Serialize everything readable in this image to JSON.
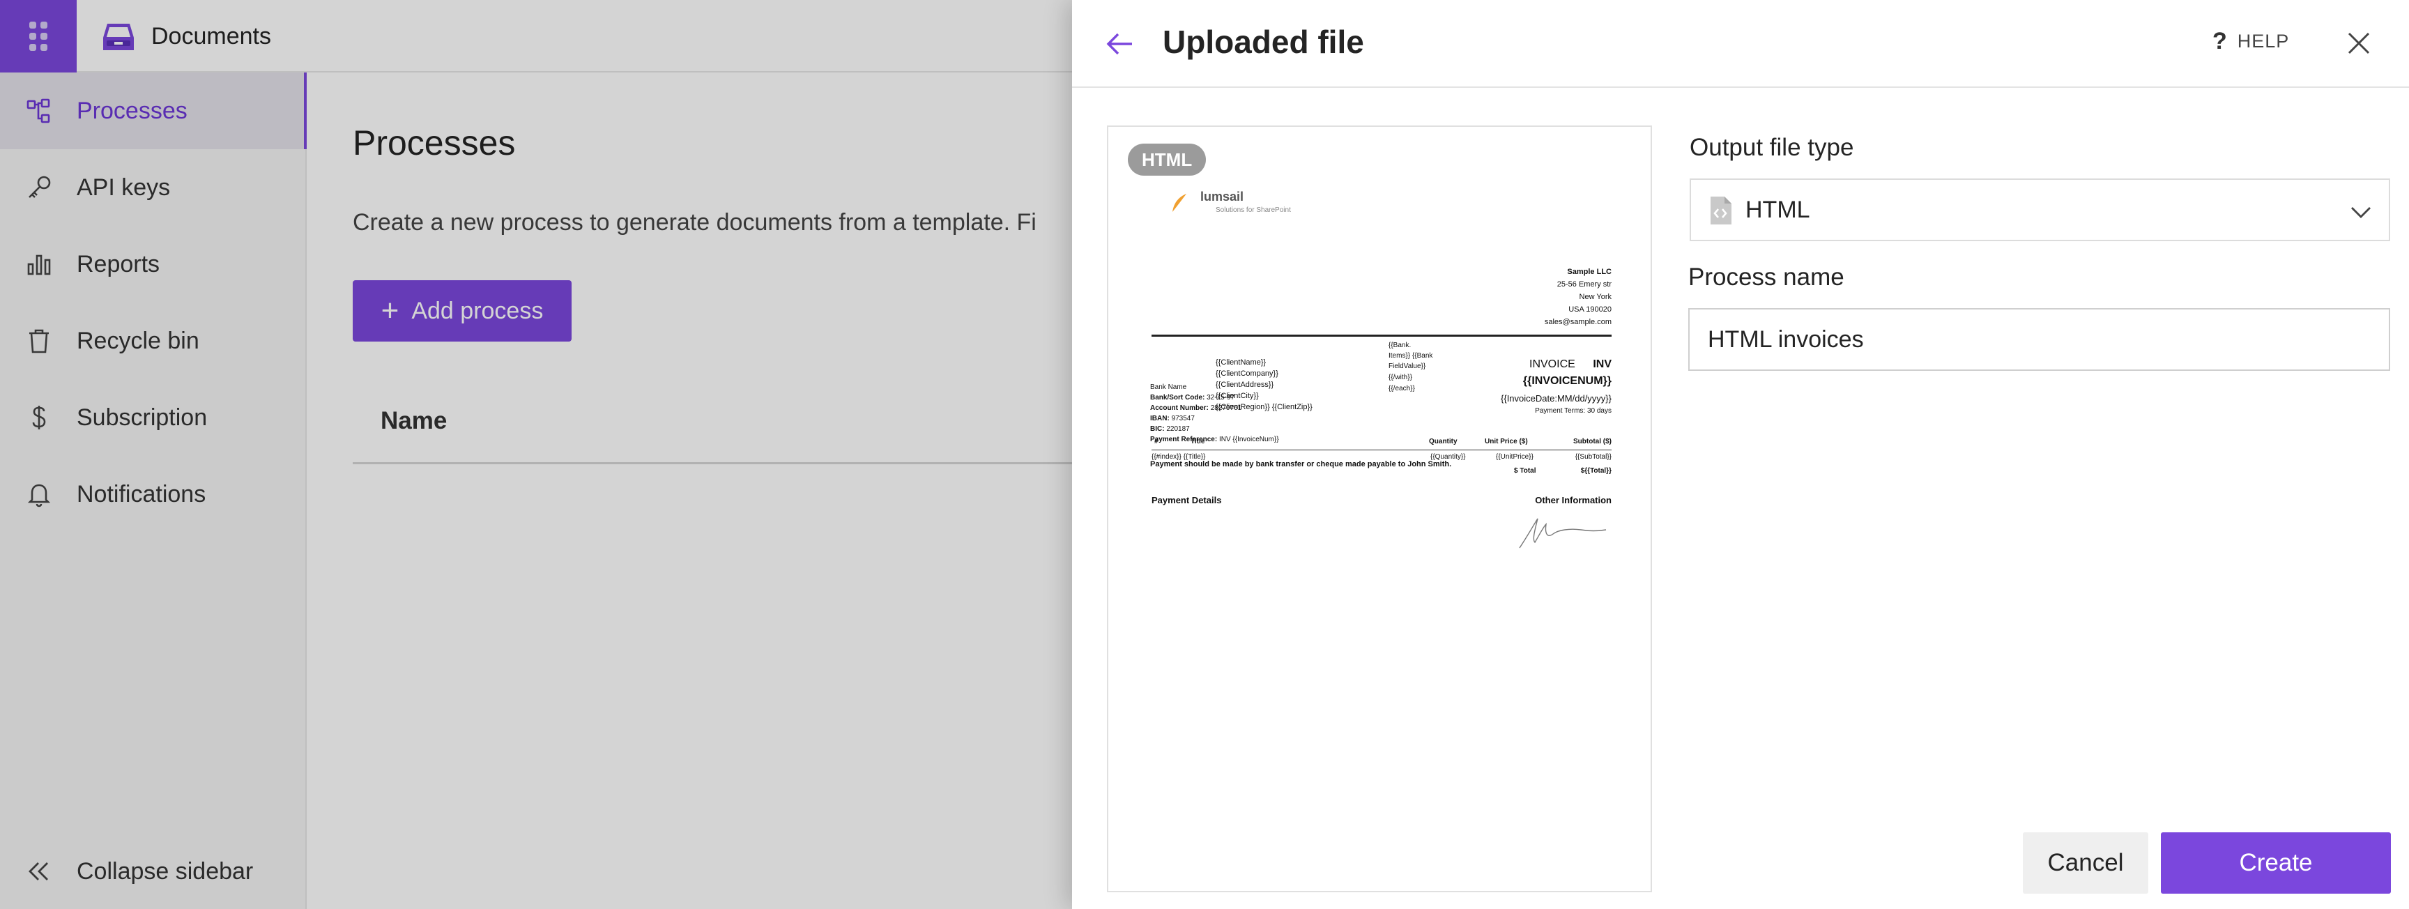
{
  "app": {
    "name": "Documents",
    "app_launcher_icon": "waffle-grid-icon",
    "brand_icon": "documents-tray-icon"
  },
  "colors": {
    "accent": "#7b47dd",
    "active_nav_bg": "#e4e1ea",
    "secondary_button_bg": "#efefef"
  },
  "sidebar": {
    "items": [
      {
        "label": "Processes",
        "icon": "processes-icon",
        "active": true
      },
      {
        "label": "API keys",
        "icon": "key-icon",
        "active": false
      },
      {
        "label": "Reports",
        "icon": "bar-chart-icon",
        "active": false
      },
      {
        "label": "Recycle bin",
        "icon": "trash-icon",
        "active": false
      },
      {
        "label": "Subscription",
        "icon": "dollar-icon",
        "active": false
      },
      {
        "label": "Notifications",
        "icon": "bell-icon",
        "active": false
      }
    ],
    "collapse_label": "Collapse sidebar"
  },
  "main": {
    "title": "Processes",
    "description": "Create a new process to generate documents from a template. Fi",
    "add_button_label": "Add process",
    "column_header": "Name"
  },
  "dialog": {
    "title": "Uploaded file",
    "help_label": "HELP",
    "preview": {
      "badge": "HTML",
      "logo_text": "lumsail",
      "logo_tagline": "Solutions for SharePoint",
      "company": [
        "Sample LLC",
        "25-56 Emery str",
        "New York",
        "USA 190020",
        "sales@sample.com"
      ],
      "bank_fields": [
        "{{Bank.",
        "Items}} {{Bank",
        "FieldValue}}",
        "{{/with}}",
        "{{/each}}"
      ],
      "client_fields": [
        "{{ClientName}}",
        "{{ClientCompany}}",
        "{{ClientAddress}}",
        "{{ClientCity}}",
        "{{ClientRegion}} {{ClientZip}}"
      ],
      "invoice_label": "INVOICE",
      "invoice_prefix": "INV",
      "invoice_number": "{{INVOICENUM}}",
      "invoice_date": "{{InvoiceDate:MM/dd/yyyy}}",
      "payment_terms": "Payment Terms: 30 days",
      "table_headers": [
        "#",
        "Title",
        "Quantity",
        "Unit Price ($)",
        "Subtotal ($)"
      ],
      "table_row": [
        "{{#index}} {{Title}}",
        "{{Quantity}}",
        "{{UnitPrice}}",
        "{{SubTotal}}"
      ],
      "total_label": "$ Total",
      "total_value": "${{Total}}",
      "payment_details_title": "Payment Details",
      "other_info_title": "Other Information",
      "payment_lines": [
        {
          "label": "Bank Name",
          "value": ""
        },
        {
          "label": "Bank/Sort Code:",
          "value": "32-75-97"
        },
        {
          "label": "Account Number:",
          "value": "28270761"
        },
        {
          "label": "IBAN:",
          "value": "973547"
        },
        {
          "label": "BIC:",
          "value": "220187"
        },
        {
          "label": "Payment Reference:",
          "value": "INV {{InvoiceNum}}"
        }
      ],
      "footer_note": "Payment should be made by bank transfer or cheque made payable to John Smith."
    },
    "output_type": {
      "label": "Output file type",
      "value": "HTML",
      "icon": "code-file-icon"
    },
    "process_name": {
      "label": "Process name",
      "value": "HTML invoices"
    },
    "cancel_label": "Cancel",
    "create_label": "Create"
  }
}
